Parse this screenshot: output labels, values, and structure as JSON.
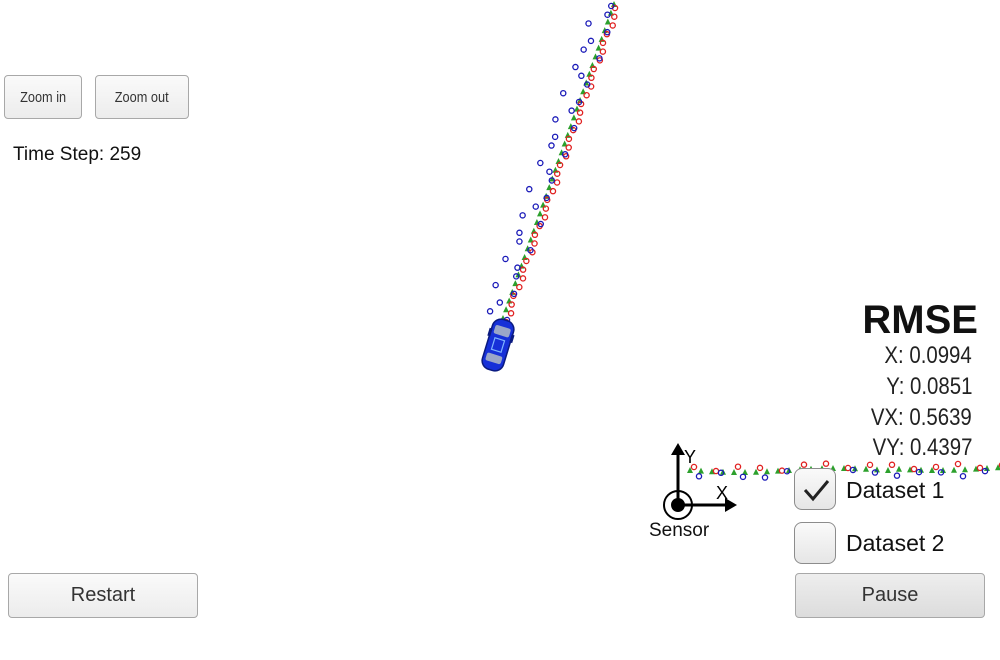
{
  "controls": {
    "zoom_in": "Zoom in",
    "zoom_out": "Zoom out",
    "restart": "Restart",
    "pause": "Pause"
  },
  "status": {
    "time_step": "Time Step: 259"
  },
  "rmse": {
    "title": "RMSE",
    "x": "X: 0.0994",
    "y": "Y: 0.0851",
    "vx": "VX: 0.5639",
    "vy": "VY: 0.4397"
  },
  "datasets": [
    {
      "label": "Dataset 1",
      "checked": true
    },
    {
      "label": "Dataset 2",
      "checked": false
    }
  ],
  "sensor": {
    "label": "Sensor",
    "x_axis": "X",
    "y_axis": "Y"
  },
  "colors": {
    "ground_truth": "#2ca02c",
    "lidar": "#e02020",
    "radar": "#1a1ab8",
    "car": "#1630d8"
  }
}
